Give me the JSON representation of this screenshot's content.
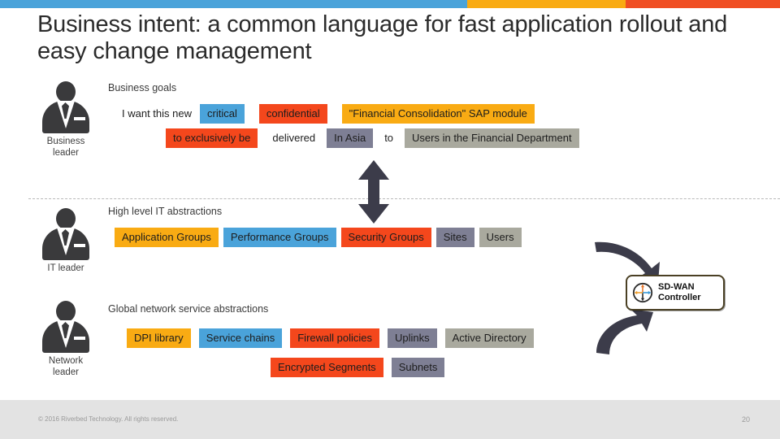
{
  "topbar": {
    "segments": [
      {
        "name": "blue",
        "color": "#4aa3da"
      },
      {
        "name": "amber",
        "color": "#f9ab13"
      },
      {
        "name": "red",
        "color": "#f04e23"
      }
    ]
  },
  "title": "Business intent: a common language for fast application rollout and easy change management",
  "personas": {
    "business": {
      "line1": "Business",
      "line2": "leader"
    },
    "it": {
      "line1": "IT leader",
      "line2": ""
    },
    "network": {
      "line1": "Network",
      "line2": "leader"
    }
  },
  "sections": {
    "business_goals": {
      "caption": "Business goals",
      "row1": [
        {
          "text": "I want this new",
          "style": "plain"
        },
        {
          "text": "critical",
          "style": "blue"
        },
        {
          "text": "confidential",
          "style": "red"
        },
        {
          "text": "\"Financial Consolidation\" SAP module",
          "style": "amber"
        }
      ],
      "row2": [
        {
          "text": "to exclusively be",
          "style": "red"
        },
        {
          "text": "delivered",
          "style": "plain"
        },
        {
          "text": "In Asia",
          "style": "slate"
        },
        {
          "text": "to",
          "style": "plain"
        },
        {
          "text": "Users in the Financial Department",
          "style": "gray"
        }
      ]
    },
    "it_abstractions": {
      "caption": "High level IT abstractions",
      "chips": [
        {
          "text": "Application Groups",
          "style": "amber"
        },
        {
          "text": "Performance Groups",
          "style": "blue"
        },
        {
          "text": "Security Groups",
          "style": "red"
        },
        {
          "text": "Sites",
          "style": "slate"
        },
        {
          "text": "Users",
          "style": "gray"
        }
      ]
    },
    "network_abstractions": {
      "caption": "Global network service abstractions",
      "row1": [
        {
          "text": "DPI library",
          "style": "amber"
        },
        {
          "text": "Service chains",
          "style": "blue"
        },
        {
          "text": "Firewall policies",
          "style": "red"
        },
        {
          "text": "Uplinks",
          "style": "slate"
        },
        {
          "text": "Active Directory",
          "style": "gray"
        }
      ],
      "row2": [
        {
          "text": "Encrypted Segments",
          "style": "red"
        },
        {
          "text": "Subnets",
          "style": "slate"
        }
      ]
    }
  },
  "sdwan": {
    "line1": "SD-WAN",
    "line2": "Controller",
    "icon": "router-icon"
  },
  "palette": {
    "blue": "#4aa3da",
    "amber": "#f9ab13",
    "red": "#f4471c",
    "slate": "#7e7f94",
    "gray": "#a9a99e",
    "arrow": "#3c3c4a"
  },
  "footer": {
    "copyright": "© 2016 Riverbed Technology. All rights reserved.",
    "page": "20"
  }
}
